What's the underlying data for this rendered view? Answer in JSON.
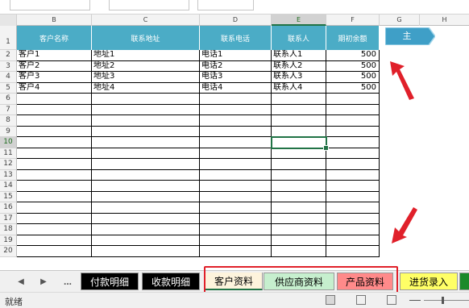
{
  "columns": [
    "B",
    "C",
    "D",
    "E",
    "F",
    "G",
    "H"
  ],
  "selected_column": "E",
  "rows": [
    "1",
    "2",
    "3",
    "4",
    "5",
    "6",
    "7",
    "8",
    "9",
    "10",
    "11",
    "12",
    "13",
    "14",
    "15",
    "16",
    "17",
    "18",
    "19",
    "20"
  ],
  "selected_row": "10",
  "table": {
    "headers": [
      "客户名称",
      "联系地址",
      "联系电话",
      "联系人",
      "期初余额"
    ],
    "data": [
      [
        "客户1",
        "地址1",
        "电话1",
        "联系人1",
        "500"
      ],
      [
        "客户2",
        "地址2",
        "电话2",
        "联系人2",
        "500"
      ],
      [
        "客户3",
        "地址3",
        "电话3",
        "联系人3",
        "500"
      ],
      [
        "客户4",
        "地址4",
        "电话4",
        "联系人4",
        "500"
      ]
    ]
  },
  "main_button_label": "主",
  "sheet_tabs": {
    "ellipsis": "...",
    "tabs": [
      {
        "label": "付款明细",
        "bg": "#000000",
        "fg": "#ffffff"
      },
      {
        "label": "收款明细",
        "bg": "#000000",
        "fg": "#ffffff"
      },
      {
        "label": "客户资料",
        "bg": "#fdf3dc",
        "fg": "#000000",
        "active": true
      },
      {
        "label": "供应商资料",
        "bg": "#c6efce",
        "fg": "#000000"
      },
      {
        "label": "产品资料",
        "bg": "#ff8a8a",
        "fg": "#000000"
      },
      {
        "label": "进货录入",
        "bg": "#ffff66",
        "fg": "#000000"
      }
    ]
  },
  "status": {
    "ready": "就绪"
  },
  "colors": {
    "header_fill": "#4bacc6",
    "accent_green": "#217346",
    "annotation_red": "#e0202a",
    "button_blue": "#3f9fc7"
  }
}
